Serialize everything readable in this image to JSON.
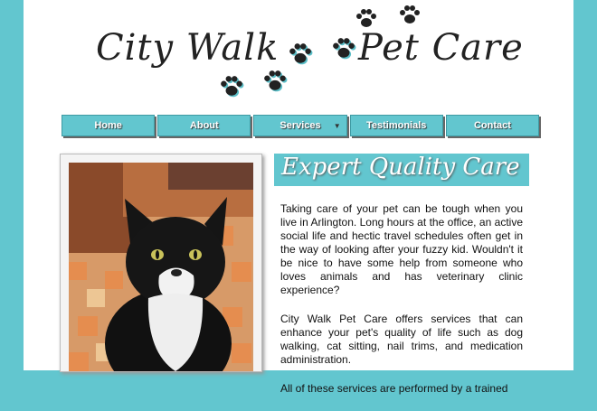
{
  "logo": {
    "part1": "City Walk",
    "part2": "Pet Care"
  },
  "nav": {
    "items": [
      {
        "label": "Home"
      },
      {
        "label": "About"
      },
      {
        "label": "Services",
        "has_dropdown": true
      },
      {
        "label": "Testimonials"
      },
      {
        "label": "Contact"
      }
    ]
  },
  "main": {
    "headline": "Expert Quality Care",
    "paragraphs": [
      "Taking care of your pet can be tough when you live in Arlington. Long hours at the office, an active social life and hectic travel schedules often get in the way of looking after your fuzzy kid. Wouldn't it be nice to have some help from someone who loves animals and has veterinary clinic experience?",
      "City Walk Pet Care offers services that can enhance your pet's quality of life such as dog walking, cat sitting, nail trims, and medication administration.",
      "All of these services are performed by a trained"
    ]
  },
  "colors": {
    "accent": "#62c6cf",
    "text": "#111111",
    "background": "#ffffff"
  }
}
